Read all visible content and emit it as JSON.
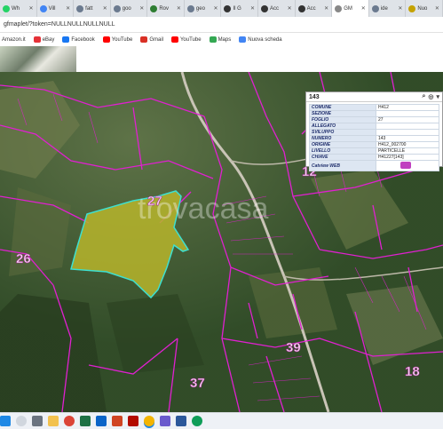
{
  "tabs": [
    {
      "label": "Wh",
      "color": "#25D366"
    },
    {
      "label": "Vill",
      "color": "#4285F4"
    },
    {
      "label": "fatt",
      "color": "#6b7a8f"
    },
    {
      "label": "goo",
      "color": "#6b7a8f"
    },
    {
      "label": "Rov",
      "color": "#2e7d32"
    },
    {
      "label": "geo",
      "color": "#6b7a8f"
    },
    {
      "label": "Il G",
      "color": "#333333"
    },
    {
      "label": "Acc",
      "color": "#333333"
    },
    {
      "label": "Acc",
      "color": "#333333"
    },
    {
      "label": "GM",
      "color": "#888888"
    },
    {
      "label": "ide",
      "color": "#6b7a8f"
    },
    {
      "label": "Nuo",
      "color": "#c5a200"
    }
  ],
  "address": {
    "url": "gfmaplet/?token=NULLNULLNULLNULL"
  },
  "bookmarks": [
    {
      "label": "Amazon.it",
      "color": "#ff9900"
    },
    {
      "label": "eBay",
      "color": "#e53238"
    },
    {
      "label": "Facebook",
      "color": "#1877f2"
    },
    {
      "label": "YouTube",
      "color": "#ff0000"
    },
    {
      "label": "Gmail",
      "color": "#d93025"
    },
    {
      "label": "YouTube",
      "color": "#ff0000"
    },
    {
      "label": "Maps",
      "color": "#34a853"
    },
    {
      "label": "Nuova scheda",
      "color": "#4285f4"
    }
  ],
  "map": {
    "watermark": "trovacasa",
    "parcel_labels": [
      "27",
      "12",
      "26",
      "39",
      "37",
      "18"
    ]
  },
  "infobox": {
    "title": "143",
    "rows": [
      {
        "key": "COMUNE",
        "value": "H412"
      },
      {
        "key": "SEZIONE",
        "value": ""
      },
      {
        "key": "FOGLIO",
        "value": "27"
      },
      {
        "key": "ALLEGATO",
        "value": ""
      },
      {
        "key": "SVILUPPO",
        "value": ""
      },
      {
        "key": "NUMERO",
        "value": "143"
      },
      {
        "key": "ORIGINE",
        "value": "H412_002700"
      },
      {
        "key": "LIVELLO",
        "value": "PARTICELLE"
      },
      {
        "key": "CHIAVE",
        "value": "H41227[143]"
      },
      {
        "key": "Catview WEB",
        "value": ""
      }
    ]
  },
  "taskbar": [
    "windows",
    "search",
    "task-view",
    "file-explorer",
    "chrome",
    "excel",
    "outlook",
    "powerpoint",
    "acrobat",
    "chrome-active",
    "calendar",
    "word",
    "chrome-2"
  ]
}
